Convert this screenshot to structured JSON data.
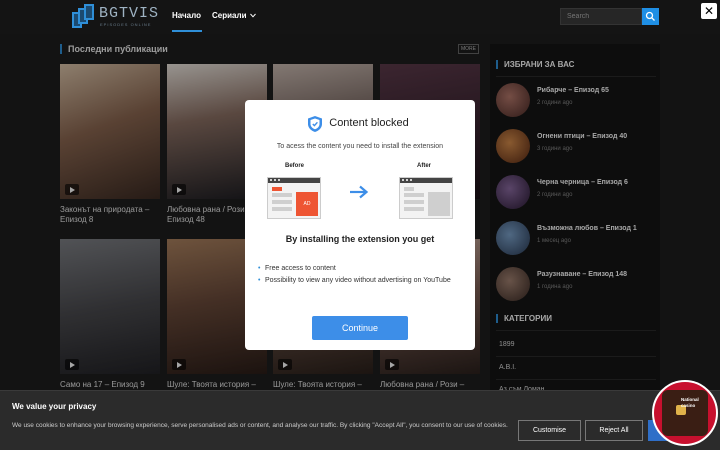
{
  "header": {
    "logo_text": "BGTVIS",
    "logo_sub": "EPISODES ONLINE",
    "nav": [
      "Начало",
      "Сериали"
    ],
    "search_placeholder": "Search"
  },
  "main": {
    "section_title": "Последни публикации",
    "more_label": "MORE",
    "cards": [
      {
        "title_l1": "Законът на природата –",
        "title_l2": "Епизод 8"
      },
      {
        "title_l1": "Любовна рана / Рози –",
        "title_l2": "Епизод 48"
      },
      {
        "title_l1": "",
        "title_l2": ""
      },
      {
        "title_l1": "",
        "title_l2": ""
      },
      {
        "title_l1": "Само на 17 – Епизод 9",
        "title_l2": ""
      },
      {
        "title_l1": "Шуле: Твоята история –",
        "title_l2": ""
      },
      {
        "title_l1": "Шуле: Твоята история –",
        "title_l2": ""
      },
      {
        "title_l1": "Любовна рана / Рози –",
        "title_l2": ""
      }
    ]
  },
  "sidebar": {
    "favorites_title": "ИЗБРАНИ ЗА ВАС",
    "favorites": [
      {
        "title": "Рибарче – Епизод 65",
        "date": "2 години ago"
      },
      {
        "title": "Огнени птици – Епизод 40",
        "date": "3 години ago"
      },
      {
        "title": "Черна черница – Епизод 6",
        "date": "2 години ago"
      },
      {
        "title": "Възможна любов – Епизод 1",
        "date": "1 месец ago"
      },
      {
        "title": "Разузнаване – Епизод 148",
        "date": "1 година ago"
      }
    ],
    "categories_title": "КАТЕГОРИИ",
    "categories": [
      "1899",
      "A.B.I.",
      "Аз съм Ломан"
    ]
  },
  "modal": {
    "title": "Content blocked",
    "subtitle": "To acess the content you need to install the extension",
    "before_label": "Before",
    "after_label": "After",
    "ad_label": "AD",
    "heading": "By installing the extension you get",
    "bullets": [
      "Free access to content",
      "Possibility to view any video without advertising on YouTube"
    ],
    "button": "Continue"
  },
  "cookie": {
    "title": "We value your privacy",
    "text": "We use cookies to enhance your browsing experience, serve personalised ads or content, and analyse our traffic. By clicking \"Accept All\", you consent to our use of cookies.",
    "customise": "Customise",
    "reject": "Reject All"
  },
  "casino_ad": {
    "label": "National casino"
  },
  "colors": {
    "accent": "#2f8fd8",
    "background": "#1e1e1e",
    "button_blue": "#3d8ee8",
    "ad_orange": "#ee5533"
  }
}
